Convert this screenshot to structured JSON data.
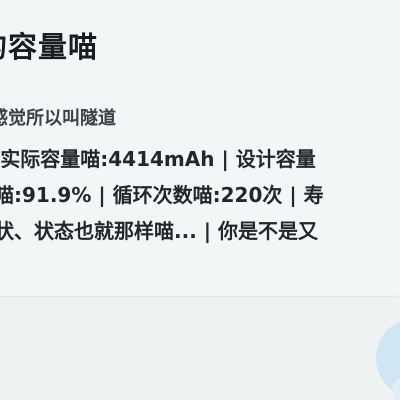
{
  "card": {
    "title": "的容量喵",
    "subtitle": "感觉所以叫隧道",
    "lines": [
      "| 实际容量喵:4414mAh | 设计容量",
      "喵:91.9% | 循环次数喵:220次 | 寿",
      "状、状态也就那样喵... | 你是不是又"
    ]
  },
  "fab": {
    "icon": "floating-action-circle"
  },
  "colors": {
    "background": "#eef2f3",
    "card": "#f3f6f7",
    "text": "#22272a",
    "accent": "#cfe6f4"
  }
}
